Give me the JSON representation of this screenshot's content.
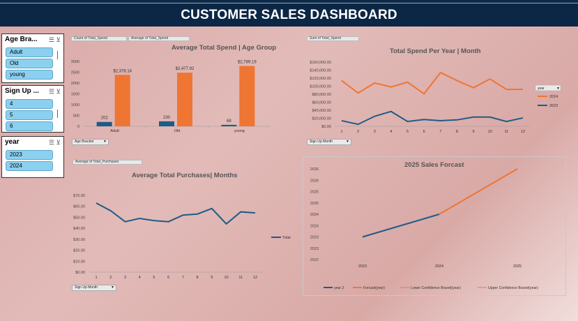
{
  "dashboard": {
    "title": "CUSTOMER SALES DASHBOARD"
  },
  "slicers": {
    "age": {
      "title": "Age Bra...",
      "items": [
        "Adult",
        "Old",
        "young"
      ]
    },
    "signup": {
      "title": "Sign Up ...",
      "items": [
        "4",
        "5",
        "6"
      ]
    },
    "year": {
      "title": "year",
      "items": [
        "2023",
        "2024"
      ]
    }
  },
  "field_chips": {
    "count_total_spend": "Count of Total_Spend",
    "avg_total_spend": "Average of Total_Spend",
    "sum_total_spend": "Sum of Total_Spend",
    "avg_total_purchases": "Average of Total_Purchases"
  },
  "dropdowns": {
    "age_bracket": "Age Bracket",
    "signup_month_1": "Sign Up Month",
    "signup_month_2": "Sign Up Month"
  },
  "colors": {
    "navy": "#1f5b86",
    "orange": "#ef7533",
    "banner": "#0b2745"
  },
  "chart_data": [
    {
      "id": "age_group",
      "type": "bar",
      "title": "Average Total Spend | Age Group",
      "categories": [
        "Adult",
        "Old",
        "young"
      ],
      "series": [
        {
          "name": "Count of Total_Spend",
          "values": [
            202,
            230,
            68
          ],
          "labels": [
            "202",
            "230",
            "68"
          ]
        },
        {
          "name": "Average of Total_Spend",
          "values": [
            2378.14,
            2477.92,
            2789.19
          ],
          "labels": [
            "$2,378.14",
            "$2,477.92",
            "$2,789.19"
          ]
        }
      ],
      "yticks": [
        "3000",
        "2500",
        "2000",
        "1500",
        "1000",
        "500",
        "0"
      ],
      "ylim": [
        0,
        3000
      ]
    },
    {
      "id": "spend_per_year",
      "type": "line",
      "title": "Total Spend Per Year | Month",
      "x": [
        1,
        2,
        3,
        4,
        5,
        6,
        7,
        8,
        9,
        10,
        11,
        12
      ],
      "series": [
        {
          "name": "2024",
          "values": [
            114000,
            83000,
            108000,
            98000,
            110000,
            81000,
            134000,
            114000,
            96000,
            118000,
            92000,
            92000
          ]
        },
        {
          "name": "2023",
          "values": [
            14000,
            5000,
            25000,
            37000,
            12000,
            17000,
            14000,
            16000,
            23000,
            23000,
            12000,
            21000
          ]
        }
      ],
      "yticks": [
        "$160,000.00",
        "$140,000.00",
        "$120,000.00",
        "$100,000.00",
        "$80,000.00",
        "$60,000.00",
        "$40,000.00",
        "$20,000.00",
        "$0.00"
      ],
      "ylim": [
        0,
        160000
      ],
      "legend_title": "year",
      "legend_position": "right"
    },
    {
      "id": "purchases_months",
      "type": "line",
      "title": "Average Total Purchases| Months",
      "x": [
        1,
        2,
        3,
        4,
        5,
        6,
        7,
        8,
        9,
        10,
        11,
        12
      ],
      "series": [
        {
          "name": "Total",
          "values": [
            63,
            56,
            46,
            49,
            47,
            46,
            52,
            53,
            58,
            44,
            55,
            54
          ]
        }
      ],
      "yticks": [
        "$70.00",
        "$60.00",
        "$50.00",
        "$40.00",
        "$30.00",
        "$20.00",
        "$10.00",
        "$0.00"
      ],
      "ylim": [
        0,
        70
      ],
      "legend_position": "right"
    },
    {
      "id": "forecast",
      "type": "line",
      "title": "2025 Sales Forcast",
      "x": [
        "2023",
        "2024",
        "2025"
      ],
      "series": [
        {
          "name": "year 2",
          "values": [
            2023,
            2024
          ]
        },
        {
          "name": "Forcast(year)",
          "values": [
            null,
            2024,
            2026
          ]
        },
        {
          "name": "Lower Confidence Bound(year)",
          "values": [
            null,
            2024,
            2026
          ]
        },
        {
          "name": "Upper Confidence Bound(year)",
          "values": [
            null,
            2024,
            2026
          ]
        }
      ],
      "yticks": [
        "2026",
        "2026",
        "2025",
        "2025",
        "2024",
        "2024",
        "2023",
        "2023",
        "2022"
      ],
      "ylim": [
        2022,
        2026
      ],
      "legend_position": "bottom"
    }
  ]
}
